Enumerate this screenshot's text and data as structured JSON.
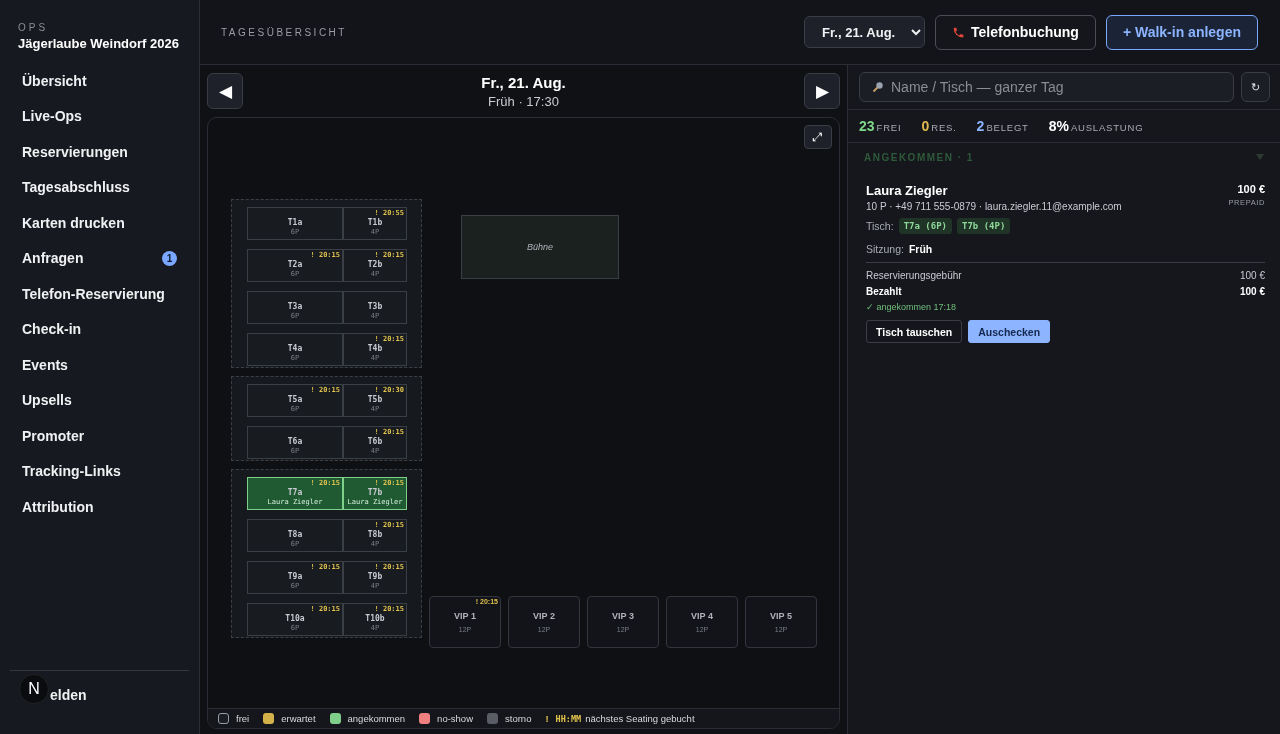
{
  "brand": {
    "kicker": "OPS",
    "title": "Jägerlaube Weindorf 2026"
  },
  "nav": [
    {
      "label": "Übersicht",
      "selected": false
    },
    {
      "label": "Live-Ops",
      "selected": false
    },
    {
      "label": "Reservierungen",
      "selected": false
    },
    {
      "label": "Tagesabschluss",
      "selected": false
    },
    {
      "label": "Karten drucken",
      "selected": false
    },
    {
      "label": "Anfragen",
      "selected": false,
      "badge": "1"
    },
    {
      "label": "Telefon-Reservierung",
      "selected": false
    },
    {
      "label": "Check-in",
      "selected": false
    },
    {
      "label": "Events",
      "selected": false
    },
    {
      "label": "Upsells",
      "selected": false
    },
    {
      "label": "Promoter",
      "selected": false
    },
    {
      "label": "Tracking-Links",
      "selected": false
    },
    {
      "label": "Attribution",
      "selected": false
    }
  ],
  "account": {
    "avatar": "N",
    "logout": "elden"
  },
  "header": {
    "title": "TAGESÜBERSICHT",
    "date": "Fr., 21. Aug.",
    "phone_button": "Telefonbuchung",
    "walkin_button": "+ Walk-in anlegen"
  },
  "floor": {
    "prev": "◀",
    "next": "▶",
    "date": "Fr., 21. Aug.",
    "session": "Früh · 17:30",
    "expand": "⤢",
    "zones": [
      {
        "rows": [
          {
            "tables": [
              {
                "name": "T1a",
                "seats": "6P",
                "arrived": false
              },
              {
                "name": "T1b",
                "seats": "4P",
                "arrived": false,
                "next": "! 20:55"
              }
            ]
          },
          {
            "tables": [
              {
                "name": "T2a",
                "seats": "6P",
                "arrived": false,
                "next": "! 20:15"
              },
              {
                "name": "T2b",
                "seats": "4P",
                "arrived": false,
                "next": "! 20:15"
              }
            ]
          },
          {
            "tables": [
              {
                "name": "T3a",
                "seats": "6P",
                "arrived": false
              },
              {
                "name": "T3b",
                "seats": "4P",
                "arrived": false
              }
            ]
          },
          {
            "tables": [
              {
                "name": "T4a",
                "seats": "6P",
                "arrived": false
              },
              {
                "name": "T4b",
                "seats": "4P",
                "arrived": false,
                "next": "! 20:15"
              }
            ]
          }
        ]
      },
      {
        "rows": [
          {
            "tables": [
              {
                "name": "T5a",
                "seats": "6P",
                "arrived": false,
                "next": "! 20:15"
              },
              {
                "name": "T5b",
                "seats": "4P",
                "arrived": false,
                "next": "! 20:30"
              }
            ]
          },
          {
            "tables": [
              {
                "name": "T6a",
                "seats": "6P",
                "arrived": false
              },
              {
                "name": "T6b",
                "seats": "4P",
                "arrived": false,
                "next": "! 20:15"
              }
            ]
          }
        ]
      },
      {
        "rows": [
          {
            "tables": [
              {
                "name": "T7a",
                "guest": "Laura Ziegler",
                "arrived": true,
                "next": "! 20:15"
              },
              {
                "name": "T7b",
                "guest": "Laura Ziegler",
                "arrived": true,
                "next": "! 20:15"
              }
            ]
          },
          {
            "tables": [
              {
                "name": "T8a",
                "seats": "6P",
                "arrived": false
              },
              {
                "name": "T8b",
                "seats": "4P",
                "arrived": false,
                "next": "! 20:15"
              }
            ]
          },
          {
            "tables": [
              {
                "name": "T9a",
                "seats": "6P",
                "arrived": false,
                "next": "! 20:15"
              },
              {
                "name": "T9b",
                "seats": "4P",
                "arrived": false,
                "next": "! 20:15"
              }
            ]
          },
          {
            "tables": [
              {
                "name": "T10a",
                "seats": "6P",
                "arrived": false,
                "next": "! 20:15"
              },
              {
                "name": "T10b",
                "seats": "4P",
                "arrived": false,
                "next": "! 20:15"
              }
            ]
          }
        ]
      }
    ],
    "stage": "Bühne",
    "vips": [
      {
        "name": "VIP 1",
        "seats": "12P",
        "arrived": false,
        "next": "! 20:15"
      },
      {
        "name": "VIP 2",
        "seats": "12P",
        "arrived": false
      },
      {
        "name": "VIP 3",
        "seats": "12P",
        "arrived": false
      },
      {
        "name": "VIP 4",
        "seats": "12P",
        "arrived": false
      },
      {
        "name": "VIP 5",
        "seats": "12P",
        "arrived": false
      }
    ],
    "legend": [
      {
        "label": "frei",
        "kind": "outline",
        "color": "#1a1d24"
      },
      {
        "label": "erwartet",
        "kind": "fill",
        "color": "#d4b24a"
      },
      {
        "label": "angekommen",
        "kind": "fill",
        "color": "#7fcf8a"
      },
      {
        "label": "no-show",
        "kind": "fill",
        "color": "#f08080"
      },
      {
        "label": "storno",
        "kind": "fill",
        "color": "#5a5d66"
      }
    ],
    "legend_mark": "!",
    "legend_time": "HH:MM",
    "legend_note": "nächstes Seating gebucht"
  },
  "panel": {
    "search_placeholder": "Name / Tisch — ganzer Tag",
    "refresh": "↻",
    "stats": [
      {
        "value": "23",
        "label": "FREI",
        "color": "#7fd68a"
      },
      {
        "value": "0",
        "label": "RES.",
        "color": "#e0b84c"
      },
      {
        "value": "2",
        "label": "BELEGT",
        "color": "#8cb4ff"
      },
      {
        "value": "8%",
        "label": "AUSLASTUNG",
        "color": "#ffffff"
      }
    ],
    "section": {
      "title": "ANGEKOMMEN · 1",
      "expanded": true
    },
    "card": {
      "name": "Laura Ziegler",
      "amount": "100 €",
      "payment": "PREPAID",
      "contact": "10 P · +49 711 555-0879 · laura.ziegler.11@example.com",
      "table_label": "Tisch:",
      "tables": [
        "T7a (6P)",
        "T7b (4P)"
      ],
      "session_label": "Sitzung:",
      "session": "Früh",
      "lines": [
        {
          "label": "Reservierungsgebühr",
          "value": "100 €",
          "bold": false
        },
        {
          "label": "Bezahlt",
          "value": "100 €",
          "bold": true
        }
      ],
      "arrived": "✓ angekommen 17:18",
      "swap_button": "Tisch tauschen",
      "checkout_button": "Auschecken"
    }
  }
}
